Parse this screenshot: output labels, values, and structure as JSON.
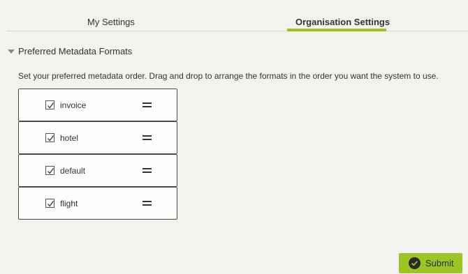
{
  "tabs": [
    {
      "label": "My Settings",
      "active": false
    },
    {
      "label": "Organisation Settings",
      "active": true
    }
  ],
  "section": {
    "title": "Preferred Metadata Formats",
    "expanded": true,
    "description": "Set your preferred metadata order. Drag and drop to arrange the formats in the order you want the system to use."
  },
  "formats": [
    {
      "label": "invoice",
      "checked": true
    },
    {
      "label": "hotel",
      "checked": true
    },
    {
      "label": "default",
      "checked": true
    },
    {
      "label": "flight",
      "checked": true
    }
  ],
  "submit": {
    "label": "Submit",
    "icon": "check-circle-icon"
  },
  "colors": {
    "accent": "#9bc522",
    "background": "#f4f2ee"
  }
}
